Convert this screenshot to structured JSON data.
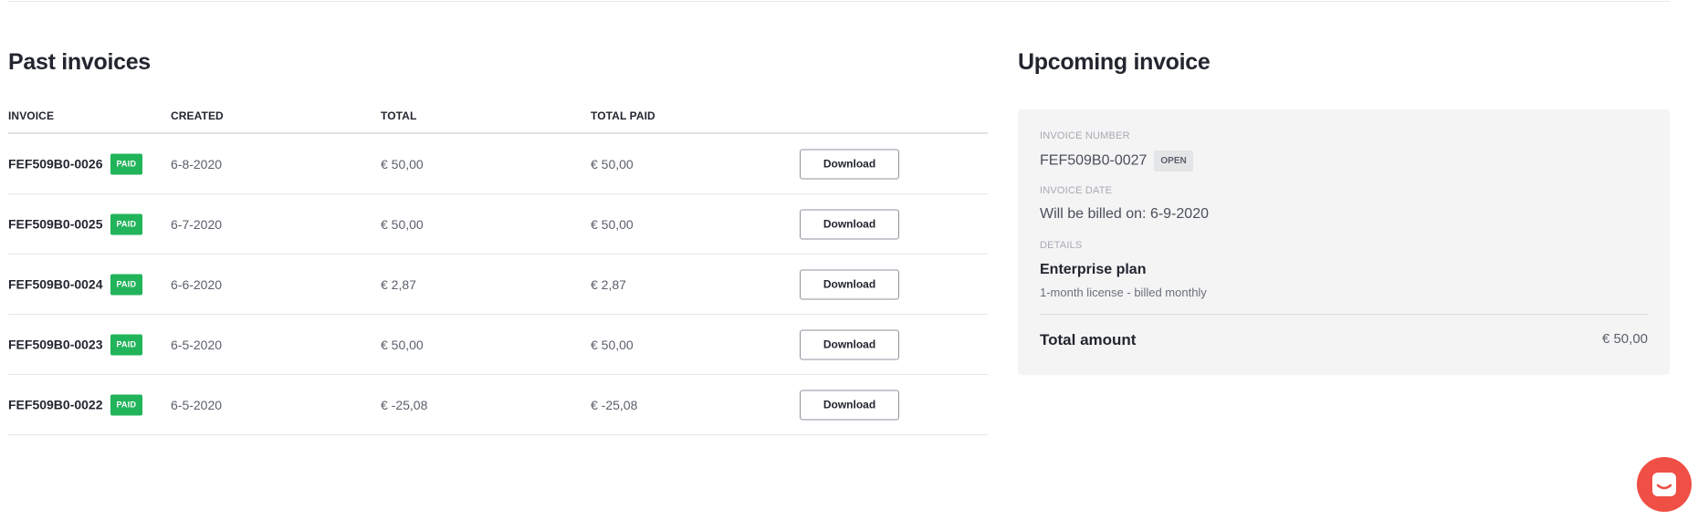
{
  "past_invoices": {
    "title": "Past invoices",
    "columns": {
      "invoice": "INVOICE",
      "created": "CREATED",
      "total": "TOTAL",
      "total_paid": "TOTAL PAID"
    },
    "rows": [
      {
        "invoice": "FEF509B0-0026",
        "status": "PAID",
        "created": "6-8-2020",
        "total": "€ 50,00",
        "total_paid": "€ 50,00",
        "action": "Download"
      },
      {
        "invoice": "FEF509B0-0025",
        "status": "PAID",
        "created": "6-7-2020",
        "total": "€ 50,00",
        "total_paid": "€ 50,00",
        "action": "Download"
      },
      {
        "invoice": "FEF509B0-0024",
        "status": "PAID",
        "created": "6-6-2020",
        "total": "€ 2,87",
        "total_paid": "€ 2,87",
        "action": "Download"
      },
      {
        "invoice": "FEF509B0-0023",
        "status": "PAID",
        "created": "6-5-2020",
        "total": "€ 50,00",
        "total_paid": "€ 50,00",
        "action": "Download"
      },
      {
        "invoice": "FEF509B0-0022",
        "status": "PAID",
        "created": "6-5-2020",
        "total": "€ -25,08",
        "total_paid": "€ -25,08",
        "action": "Download"
      }
    ]
  },
  "upcoming_invoice": {
    "title": "Upcoming invoice",
    "invoice_number_label": "INVOICE NUMBER",
    "invoice_number": "FEF509B0-0027",
    "status": "OPEN",
    "invoice_date_label": "INVOICE DATE",
    "invoice_date": "Will be billed on: 6-9-2020",
    "details_label": "DETAILS",
    "plan_name": "Enterprise plan",
    "plan_description": "1-month license - billed monthly",
    "total_label": "Total amount",
    "total_value": "€ 50,00"
  },
  "chat_launcher": {
    "icon": "chat-bubble-icon"
  },
  "colors": {
    "paid_badge": "#21b45b",
    "open_badge": "#e4e5e7",
    "card_background": "#f4f4f5",
    "chat_launcher": "#ef4f45"
  }
}
